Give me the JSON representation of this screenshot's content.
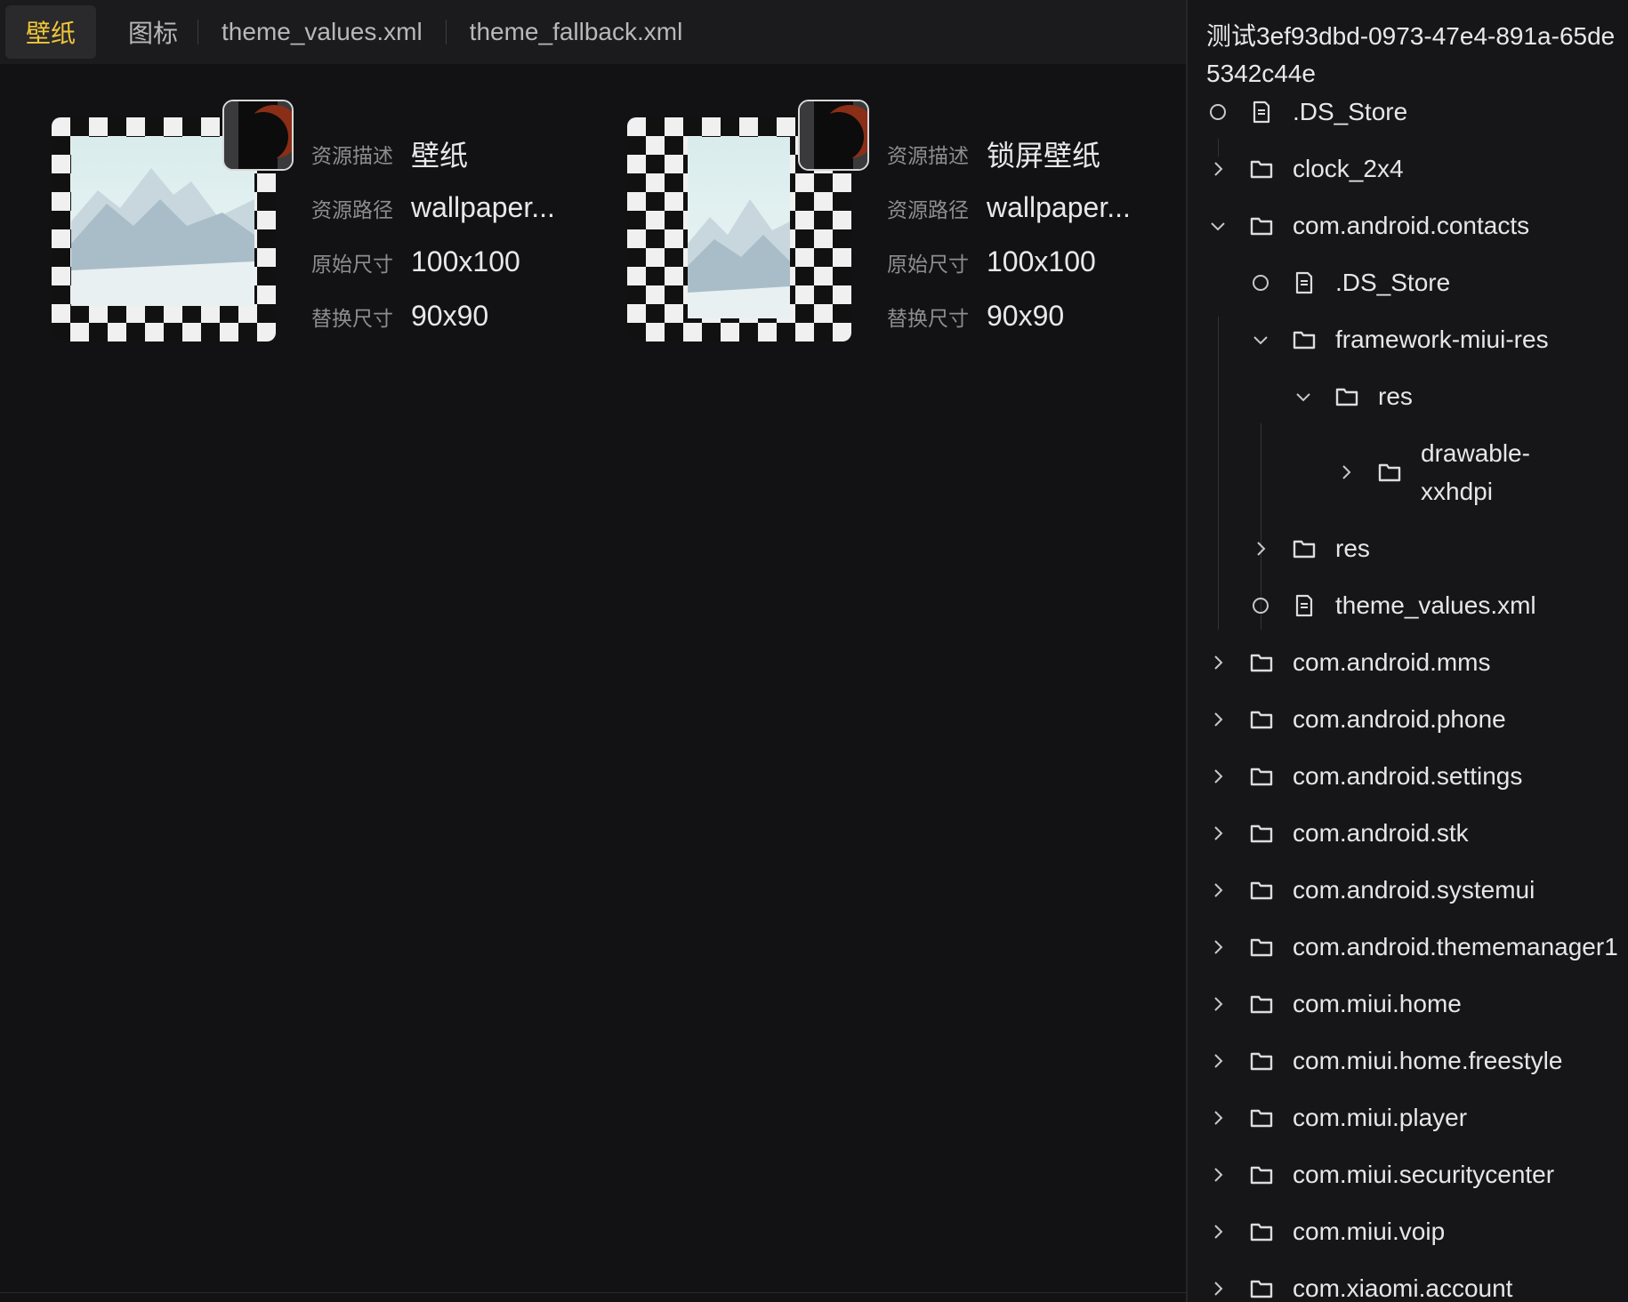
{
  "tabs": [
    {
      "label": "壁纸",
      "active": true
    },
    {
      "label": "图标",
      "active": false
    },
    {
      "label": "theme_values.xml",
      "active": false
    },
    {
      "label": "theme_fallback.xml",
      "active": false
    }
  ],
  "cards": [
    {
      "desc_label": "资源描述",
      "desc": "壁纸",
      "path_label": "资源路径",
      "path": "wallpaper...",
      "orig_label": "原始尺寸",
      "orig": "100x100",
      "repl_label": "替换尺寸",
      "repl": "90x90"
    },
    {
      "desc_label": "资源描述",
      "desc": "锁屏壁纸",
      "path_label": "资源路径",
      "path": "wallpaper...",
      "orig_label": "原始尺寸",
      "orig": "100x100",
      "repl_label": "替换尺寸",
      "repl": "90x90"
    }
  ],
  "panel": {
    "title": "测试3ef93dbd-0973-47e4-891a-65de5342c44e",
    "tree": [
      {
        "label": ".DS_Store",
        "type": "file",
        "depth": 0,
        "state": "leaf"
      },
      {
        "label": "clock_2x4",
        "type": "folder",
        "depth": 0,
        "state": "collapsed"
      },
      {
        "label": "com.android.contacts",
        "type": "folder",
        "depth": 0,
        "state": "expanded"
      },
      {
        "label": ".DS_Store",
        "type": "file",
        "depth": 1,
        "state": "leaf"
      },
      {
        "label": "framework-miui-res",
        "type": "folder",
        "depth": 1,
        "state": "expanded"
      },
      {
        "label": "res",
        "type": "folder",
        "depth": 2,
        "state": "expanded"
      },
      {
        "label": "drawable-xxhdpi",
        "type": "folder",
        "depth": 3,
        "state": "collapsed"
      },
      {
        "label": "res",
        "type": "folder",
        "depth": 1,
        "state": "collapsed"
      },
      {
        "label": "theme_values.xml",
        "type": "file",
        "depth": 1,
        "state": "leaf"
      },
      {
        "label": "com.android.mms",
        "type": "folder",
        "depth": 0,
        "state": "collapsed"
      },
      {
        "label": "com.android.phone",
        "type": "folder",
        "depth": 0,
        "state": "collapsed"
      },
      {
        "label": "com.android.settings",
        "type": "folder",
        "depth": 0,
        "state": "collapsed"
      },
      {
        "label": "com.android.stk",
        "type": "folder",
        "depth": 0,
        "state": "collapsed"
      },
      {
        "label": "com.android.systemui",
        "type": "folder",
        "depth": 0,
        "state": "collapsed"
      },
      {
        "label": "com.android.thememanager1",
        "type": "folder",
        "depth": 0,
        "state": "collapsed"
      },
      {
        "label": "com.miui.home",
        "type": "folder",
        "depth": 0,
        "state": "collapsed"
      },
      {
        "label": "com.miui.home.freestyle",
        "type": "folder",
        "depth": 0,
        "state": "collapsed"
      },
      {
        "label": "com.miui.player",
        "type": "folder",
        "depth": 0,
        "state": "collapsed"
      },
      {
        "label": "com.miui.securitycenter",
        "type": "folder",
        "depth": 0,
        "state": "collapsed"
      },
      {
        "label": "com.miui.voip",
        "type": "folder",
        "depth": 0,
        "state": "collapsed"
      },
      {
        "label": "com.xiaomi.account",
        "type": "folder",
        "depth": 0,
        "state": "collapsed"
      }
    ]
  },
  "colors": {
    "accent": "#f0c63a",
    "background": "#121214",
    "panel": "#161618"
  }
}
